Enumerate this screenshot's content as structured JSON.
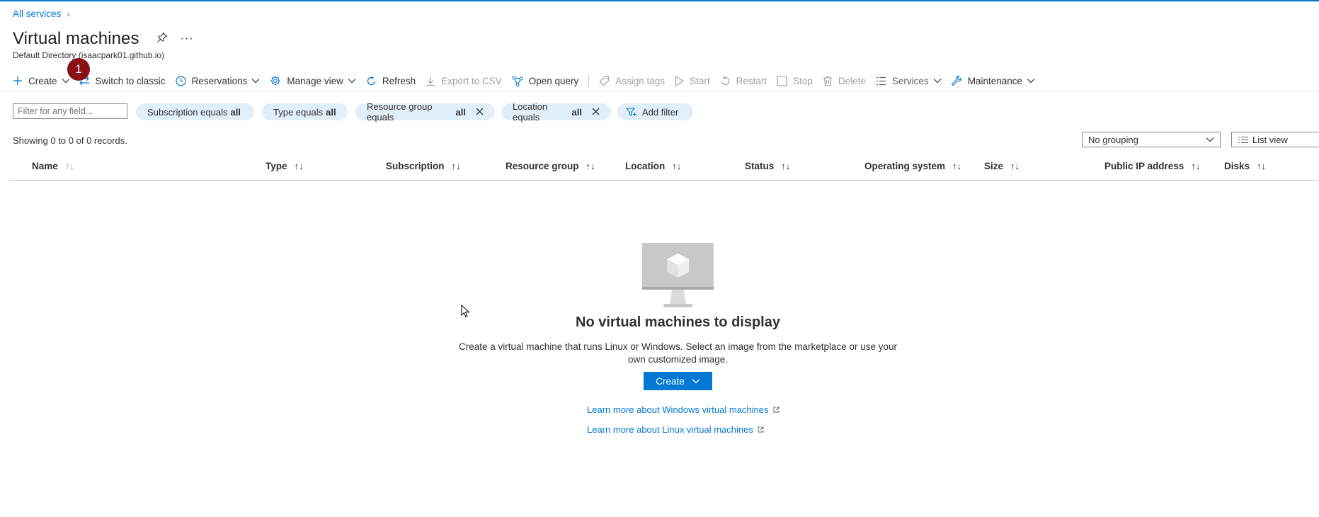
{
  "breadcrumb": {
    "all_services": "All services",
    "chevron": "›"
  },
  "page": {
    "title": "Virtual machines",
    "subtitle": "Default Directory (isaacpark01.github.io)",
    "more": "···"
  },
  "badge": {
    "number": "1"
  },
  "toolbar": {
    "create": "Create",
    "switch_classic": "Switch to classic",
    "reservations": "Reservations",
    "manage_view": "Manage view",
    "refresh": "Refresh",
    "export_csv": "Export to CSV",
    "open_query": "Open query",
    "assign_tags": "Assign tags",
    "start": "Start",
    "restart": "Restart",
    "stop": "Stop",
    "delete": "Delete",
    "services": "Services",
    "maintenance": "Maintenance"
  },
  "filters": {
    "search_placeholder": "Filter for any field...",
    "subscription_label": "Subscription equals",
    "subscription_value": "all",
    "type_label": "Type equals",
    "type_value": "all",
    "resource_group_label": "Resource group equals",
    "resource_group_value": "all",
    "location_label": "Location equals",
    "location_value": "all",
    "add_filter": "Add filter"
  },
  "records": "Showing 0 to 0 of 0 records.",
  "grouping": {
    "selected": "No grouping"
  },
  "view": {
    "selected": "List view"
  },
  "columns": {
    "name": "Name",
    "type": "Type",
    "subscription": "Subscription",
    "resource_group": "Resource group",
    "location": "Location",
    "status": "Status",
    "os": "Operating system",
    "size": "Size",
    "public_ip": "Public IP address",
    "disks": "Disks"
  },
  "empty_state": {
    "title": "No virtual machines to display",
    "description": "Create a virtual machine that runs Linux or Windows. Select an image from the marketplace or use your own customized image.",
    "create_button": "Create",
    "link_windows": "Learn more about Windows virtual machines",
    "link_linux": "Learn more about Linux virtual machines"
  },
  "colors": {
    "accent": "#0078d4",
    "badge": "#8a0f17",
    "pill_bg": "#e1effa"
  }
}
